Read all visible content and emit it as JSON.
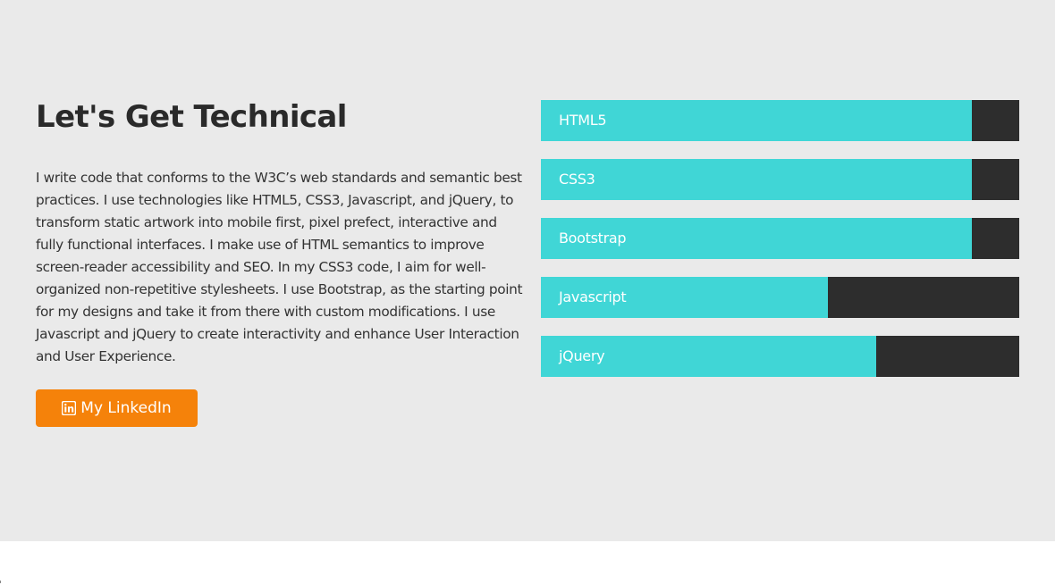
{
  "section": {
    "title": "Let's Get Technical",
    "description": "I write code that conforms to the W3C’s web standards and semantic best practices. I use technologies like HTML5, CSS3, Javascript, and jQuery, to transform static artwork into mobile first, pixel prefect, interactive and fully functional interfaces. I make use of HTML semantics to improve screen-reader accessibility and SEO. In my CSS3 code, I aim for well-organized non-repetitive stylesheets. I use Bootstrap, as the starting point for my designs and take it from there with custom modifications. I use Javascript and jQuery to create interactivity and enhance User Interaction and User Experience.",
    "linkedin_button": {
      "label": "My LinkedIn",
      "icon": "linkedin-icon"
    }
  },
  "skills": [
    {
      "label": "HTML5",
      "percent": 90
    },
    {
      "label": "CSS3",
      "percent": 90
    },
    {
      "label": "Bootstrap",
      "percent": 90
    },
    {
      "label": "Javascript",
      "percent": 60
    },
    {
      "label": "jQuery",
      "percent": 70
    }
  ],
  "colors": {
    "background": "#eaeaea",
    "bar_fill": "#40d6d6",
    "bar_track": "#2d2d2d",
    "button": "#f5820a",
    "heading": "#2a2a2a"
  }
}
